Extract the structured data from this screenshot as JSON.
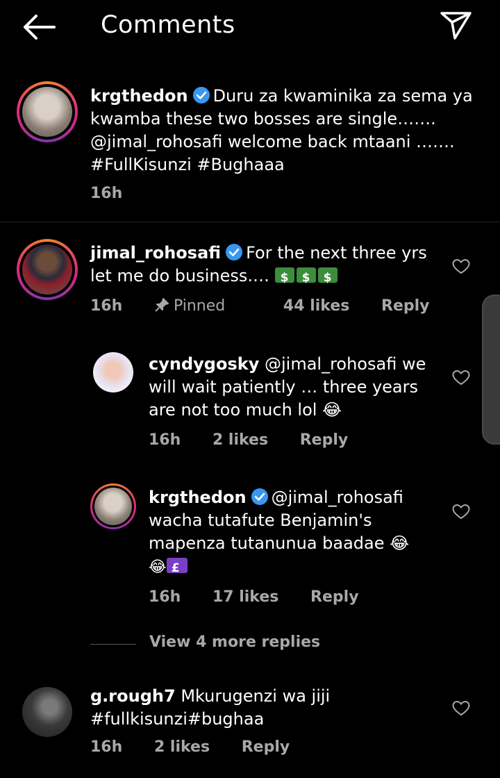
{
  "header": {
    "title": "Comments",
    "back_icon": "back-arrow-icon",
    "share_icon": "send-icon"
  },
  "caption": {
    "username": "krgthedon",
    "text": "Duru za kwaminika za sema ya kwamba these two bosses are single……. @jimal_rohosafi welcome back mtaani ……. #FullKisunzi #Bughaaa",
    "time": "16h"
  },
  "comments": [
    {
      "username": "jimal_rohosafi",
      "text": "For the next three yrs let me do business.…",
      "time": "16h",
      "pinned": "Pinned",
      "likes": "44 likes",
      "reply": "Reply"
    },
    {
      "username": "cyndygosky",
      "text": "@jimal_rohosafi we will wait patiently … three years are not too much lol 😂",
      "time": "16h",
      "likes": "2 likes",
      "reply": "Reply"
    },
    {
      "username": "krgthedon",
      "text": "@jimal_rohosafi wacha tutafute Benjamin's mapenza tutanunua baadae 😂",
      "text2": "😂",
      "time": "16h",
      "likes": "17 likes",
      "reply": "Reply"
    },
    {
      "username": "g.rough7",
      "text": "Mkurugenzi wa jiji #fullkisunzi#bughaa",
      "time": "16h",
      "likes": "2 likes",
      "reply": "Reply"
    }
  ],
  "view_more": "View 4 more replies",
  "colors": {
    "background": "#000000",
    "muted": "#a8a8a8",
    "verified": "#3897f0"
  }
}
